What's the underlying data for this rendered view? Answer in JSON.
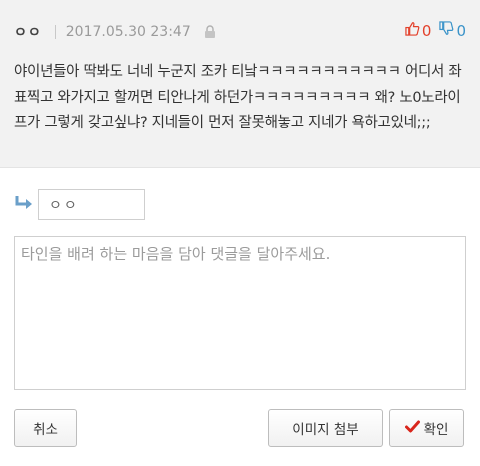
{
  "comment": {
    "author": "ㅇㅇ",
    "date": "2017.05.30 23:47",
    "upvotes": "0",
    "downvotes": "0",
    "body": "야이년들아 딱봐도 너네 누군지 조카 티낰ㅋㅋㅋㅋㅋㅋㅋㅋㅋㅋㅋ 어디서 좌표찍고 와가지고 할꺼면 티안나게 하던가ㅋㅋㅋㅋㅋㅋㅋㅋㅋ 왜? 노0노라이프가 그렇게 갖고싶냐? 지네들이 먼저 잘못해놓고 지네가 욕하고있네;;;"
  },
  "form": {
    "name_value": "ㅇㅇ",
    "placeholder": "타인을 배려 하는 마음을 담아 댓글을 달아주세요.",
    "cancel_label": "취소",
    "image_label": "이미지 첨부",
    "ok_label": "확인"
  },
  "colors": {
    "up": "#e3412b",
    "down": "#3a93c9",
    "check": "#d9261c",
    "arrow": "#6a9fc9"
  },
  "icons": {
    "lock": "lock-icon",
    "up": "thumbs-up-icon",
    "down": "thumbs-down-icon",
    "reply": "reply-arrow-icon",
    "check": "check-icon"
  }
}
